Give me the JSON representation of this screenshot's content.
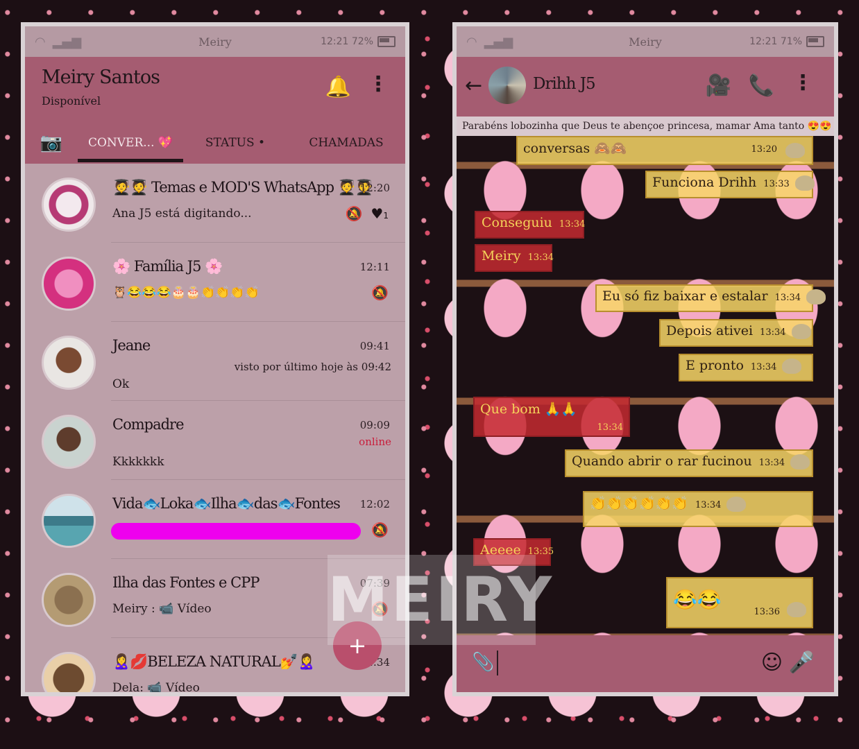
{
  "status_bar_left": {
    "network_label": "Meiry",
    "time_battery": "12:21 72%"
  },
  "status_bar_right": {
    "network_label": "Meiry",
    "time_battery": "12:21 71%"
  },
  "left_screen": {
    "header": {
      "title": "Meiry Santos",
      "subtitle": "Disponível",
      "menu_glyph": "⋮"
    },
    "tabs": [
      {
        "label": "📷",
        "icon": "camera-icon"
      },
      {
        "label": "CONVER... 💖",
        "active": true
      },
      {
        "label": "STATUS •"
      },
      {
        "label": "CHAMADAS"
      }
    ],
    "chats": [
      {
        "name": "🧑‍🎓🧑‍🎓 Temas e MOD'S WhatsApp 🧑‍🎓🧑‍🎓",
        "time": "12:20",
        "message": "Ana J5 está digitando...",
        "unread": "1"
      },
      {
        "name": "🌸 Família J5 🌸",
        "time": "12:11",
        "message": "🦉😂😂😂🎂🎂👏👏👏👏"
      },
      {
        "name": "Jeane",
        "time": "09:41",
        "extra": "visto por último hoje às 09:42",
        "message": "Ok"
      },
      {
        "name": "Compadre",
        "time": "09:09",
        "extra": "online",
        "message": "Kkkkkkk"
      },
      {
        "name": "Vida🐟Loka🐟Ilha🐟das🐟Fontes",
        "time": "12:02",
        "message": ""
      },
      {
        "name": "Ilha das Fontes e CPP",
        "time": "07:39",
        "message": "Meiry : 📹 Vídeo"
      },
      {
        "name": "🙎‍♀️💋BELEZA NATURAL💅🙎‍♀️",
        "time": "…34",
        "message": "Dela: 📹 Vídeo"
      }
    ],
    "fab_label": "+"
  },
  "right_screen": {
    "header": {
      "back_glyph": "←",
      "contact_name": "Drihh J5",
      "menu_glyph": "⋮"
    },
    "banner": "Parabéns lobozinha que Deus te abençoe princesa, mamar Ama tanto 😍😍",
    "messages": [
      {
        "text": "conversas 🙈🙈",
        "time": "13:20",
        "dir": "out"
      },
      {
        "text": "Funciona Drihh",
        "time": "13:33",
        "dir": "out"
      },
      {
        "text": "Conseguiu",
        "time": "13:34",
        "dir": "in"
      },
      {
        "text": "Meiry",
        "time": "13:34",
        "dir": "in"
      },
      {
        "text": "Eu só fiz baixar e estalar",
        "time": "13:34",
        "dir": "out"
      },
      {
        "text": "Depois ativei",
        "time": "13:34",
        "dir": "out"
      },
      {
        "text": "E pronto",
        "time": "13:34",
        "dir": "out"
      },
      {
        "text": "Que bom 🙏🙏",
        "time": "13:34",
        "dir": "in"
      },
      {
        "text": "Quando abrir o rar fucinou",
        "time": "13:34",
        "dir": "out"
      },
      {
        "text": "👏👏👏👏👏👏",
        "time": "13:34",
        "dir": "out"
      },
      {
        "text": "Aeeee",
        "time": "13:35",
        "dir": "in"
      },
      {
        "text": "😂😂",
        "time": "13:36",
        "dir": "out"
      }
    ]
  },
  "watermark": "MEIRY",
  "colors": {
    "header": "#a55c71",
    "list_bg": "#bca0a9",
    "online": "#c81d3b",
    "outgoing_bubble": "#f7d666",
    "incoming_bubble": "#c42a30"
  }
}
